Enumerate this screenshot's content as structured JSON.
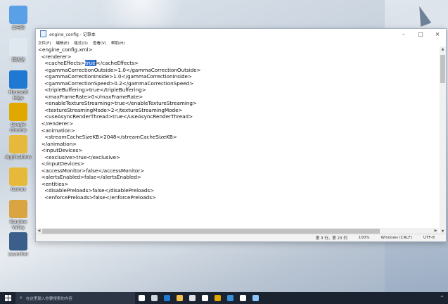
{
  "desktop": {
    "icons": [
      {
        "label": "此电脑",
        "color": "#5aa0e6"
      },
      {
        "label": "回收站",
        "color": "#dfe7ef"
      },
      {
        "label": "Microsoft Edge",
        "color": "#1f78d1"
      },
      {
        "label": "Google Chrome",
        "color": "#e0a800"
      },
      {
        "label": "Applications",
        "color": "#e6b93b"
      },
      {
        "label": "Games",
        "color": "#e6b93b"
      },
      {
        "label": "Stardew Valley",
        "color": "#d9a441"
      },
      {
        "label": "Launcher",
        "color": "#3a5f8a"
      }
    ]
  },
  "window": {
    "title": "engine_config - 记事本",
    "controls": {
      "minimize": "–",
      "maximize": "□",
      "close": "×"
    },
    "menu": [
      "文件(F)",
      "编辑(E)",
      "格式(O)",
      "查看(V)",
      "帮助(H)"
    ],
    "lines": [
      {
        "text": "<engine_config.xml>"
      },
      {
        "text": "  <renderer>"
      },
      {
        "before": "    <cacheEffects>",
        "selected": "true",
        "after": "</cacheEffects>"
      },
      {
        "text": "    <gammaCorrectionOutside>1.0</gammaCorrectionOutside>"
      },
      {
        "text": "    <gammaCorrectionInside>1.0</gammaCorrectionInside>"
      },
      {
        "text": "    <gammaCorrectionSpeed>0.2</gammaCorrectionSpeed>"
      },
      {
        "text": "    <tripleBuffering>true</tripleBuffering>"
      },
      {
        "text": "    <maxFrameRate>0</maxFrameRate>"
      },
      {
        "text": "    <enableTextureStreaming>true</enableTextureStreaming>"
      },
      {
        "text": "    <textureStreamingMode>2</textureStreamingMode>"
      },
      {
        "text": "    <useAsyncRenderThread>true</useAsyncRenderThread>"
      },
      {
        "text": "  </renderer>"
      },
      {
        "text": "  <animation>"
      },
      {
        "text": "    <streamCacheSizeKB>2048</streamCacheSizeKB>"
      },
      {
        "text": "  </animation>"
      },
      {
        "text": "  <inputDevices>"
      },
      {
        "text": "    <exclusive>true</exclusive>"
      },
      {
        "text": "  </inputDevices>"
      },
      {
        "text": "  <accessMonitor>false</accessMonitor>"
      },
      {
        "text": "  <alertsEnabled>false</alertsEnabled>"
      },
      {
        "text": "  <entities>"
      },
      {
        "text": "    <disablePreloads>false</disablePreloads>"
      },
      {
        "text": "    <enforcePreloads>false</enforcePreloads>"
      }
    ],
    "status": {
      "position": "第 3 行，第 23 列",
      "zoom": "100%",
      "line_ending": "Windows (CRLF)",
      "encoding": "UTF-8"
    }
  },
  "taskbar": {
    "search_placeholder": "在这里输入你要搜索的内容",
    "apps": [
      {
        "name": "cortana",
        "color": "#ffffff"
      },
      {
        "name": "task-view",
        "color": "#cfd6df"
      },
      {
        "name": "edge",
        "color": "#1f78d1"
      },
      {
        "name": "file-explorer",
        "color": "#f2c14e"
      },
      {
        "name": "store",
        "color": "#dfe3e8"
      },
      {
        "name": "mail",
        "color": "#ffffff"
      },
      {
        "name": "chrome",
        "color": "#e0a800"
      },
      {
        "name": "launcher",
        "color": "#3a8fd9"
      },
      {
        "name": "settings",
        "color": "#ffffff"
      },
      {
        "name": "notepad",
        "color": "#8cc6ff"
      }
    ],
    "tray_symbol": "^"
  }
}
